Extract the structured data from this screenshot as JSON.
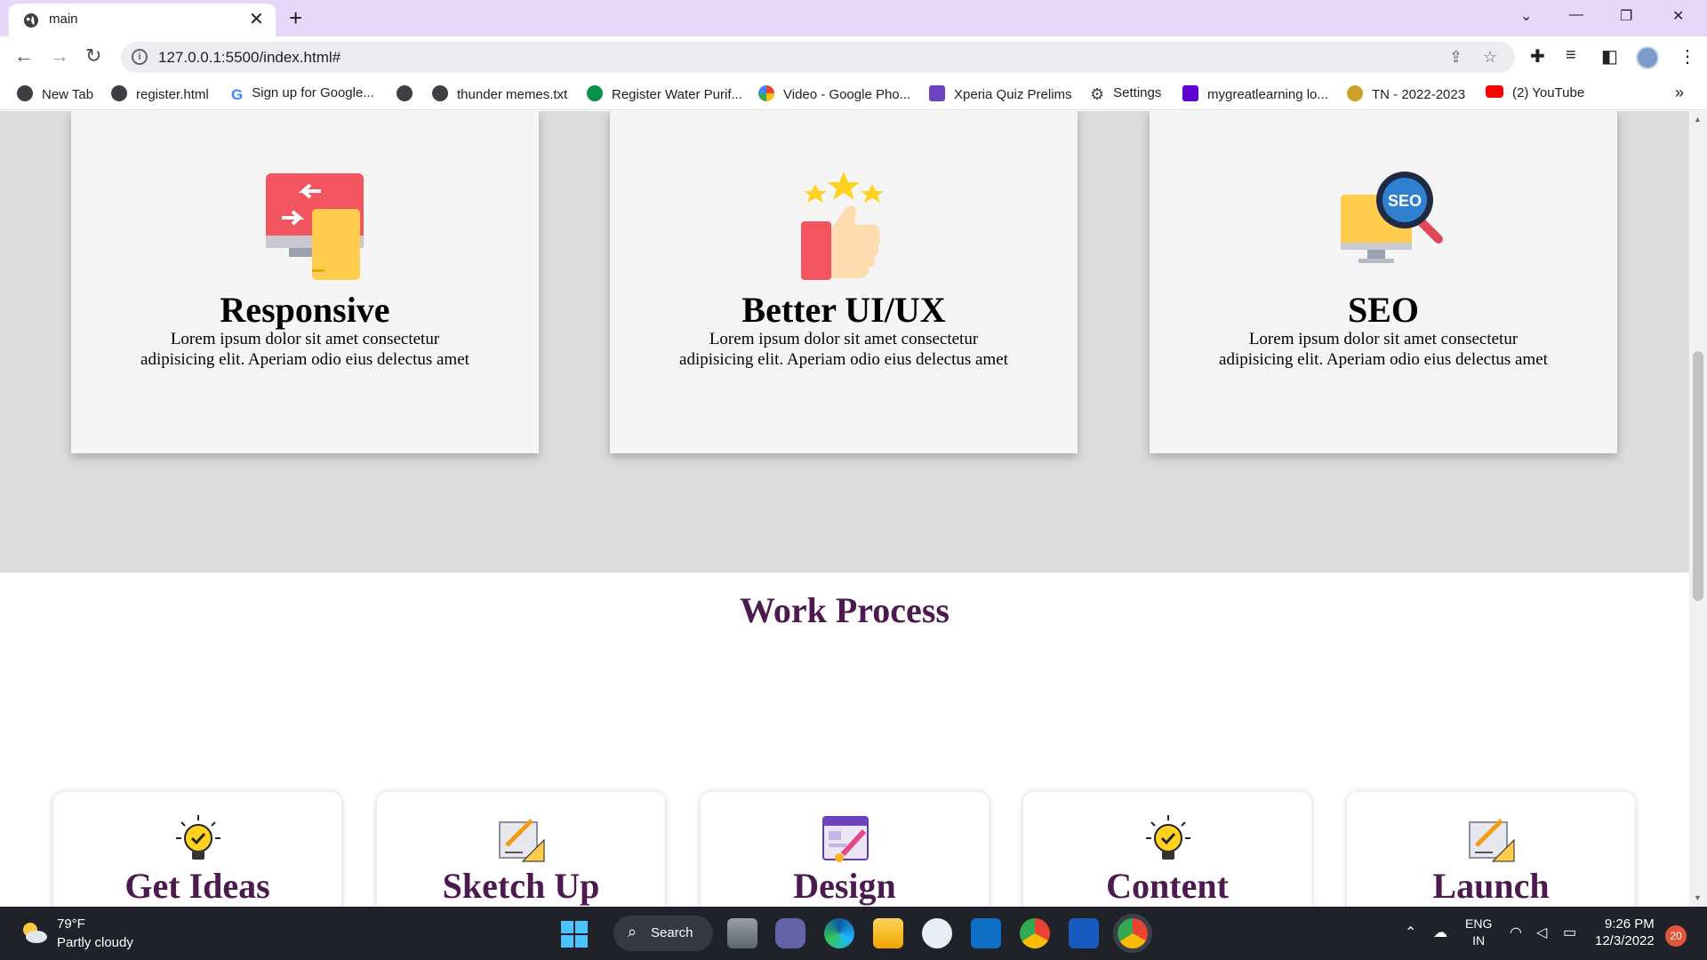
{
  "browser": {
    "tab_title": "main",
    "tab_close": "✕",
    "new_tab": "+",
    "url": "127.0.0.1:5500/index.html#",
    "window_controls": {
      "list": "⌄",
      "minimize": "—",
      "restore": "❐",
      "close": "✕"
    }
  },
  "bookmarks": [
    {
      "label": "New Tab",
      "icon": "globe-icon",
      "color": "#3c4043"
    },
    {
      "label": "register.html",
      "icon": "globe-icon",
      "color": "#3c4043"
    },
    {
      "label": "Sign up for Google...",
      "icon": "google-icon",
      "color": "#4285f4"
    },
    {
      "label": "",
      "icon": "globe-icon",
      "color": "#3c4043"
    },
    {
      "label": "thunder memes.txt",
      "icon": "globe-icon",
      "color": "#3c4043"
    },
    {
      "label": "Register Water Purif...",
      "icon": "ac-icon",
      "color": "#0a8f4c"
    },
    {
      "label": "Video - Google Pho...",
      "icon": "photos-icon",
      "color": "#fbbc05"
    },
    {
      "label": "Xperia Quiz Prelims",
      "icon": "forms-icon",
      "color": "#6f42c1"
    },
    {
      "label": "Settings",
      "icon": "gear-icon",
      "color": "#3c4043"
    },
    {
      "label": "mygreatlearning lo...",
      "icon": "yahoo-icon",
      "color": "#6001d2"
    },
    {
      "label": "TN - 2022-2023",
      "icon": "emblem-icon",
      "color": "#c9a227"
    },
    {
      "label": "(2) YouTube",
      "icon": "youtube-icon",
      "color": "#ff0000"
    }
  ],
  "bookmarks_more": "»",
  "features": [
    {
      "title": "Responsive",
      "text": "Lorem ipsum dolor sit amet consectetur adipisicing elit. Aperiam odio eius delectus amet",
      "icon": "responsive-devices-icon"
    },
    {
      "title": "Better UI/UX",
      "text": "Lorem ipsum dolor sit amet consectetur adipisicing elit. Aperiam odio eius delectus amet",
      "icon": "thumbs-up-stars-icon"
    },
    {
      "title": "SEO",
      "text": "Lorem ipsum dolor sit amet consectetur adipisicing elit. Aperiam odio eius delectus amet",
      "icon": "seo-magnifier-icon",
      "icon_text": "SEO"
    }
  ],
  "work_process": {
    "title": "Work Process",
    "steps": [
      {
        "label": "Get Ideas",
        "icon": "lightbulb-icon"
      },
      {
        "label": "Sketch Up",
        "icon": "sketch-ruler-icon"
      },
      {
        "label": "Design",
        "icon": "design-brush-icon"
      },
      {
        "label": "Content",
        "icon": "lightbulb-icon"
      },
      {
        "label": "Launch",
        "icon": "sketch-ruler-icon"
      }
    ]
  },
  "taskbar": {
    "weather_temp": "79°F",
    "weather_desc": "Partly cloudy",
    "search_label": "Search",
    "lang_1": "ENG",
    "lang_2": "IN",
    "time": "9:26 PM",
    "date": "12/3/2022",
    "notifications": "20"
  },
  "colors": {
    "accent": "#4d1a50",
    "section_bg": "#dcdcdc",
    "tab_strip": "#e7d7f9"
  }
}
